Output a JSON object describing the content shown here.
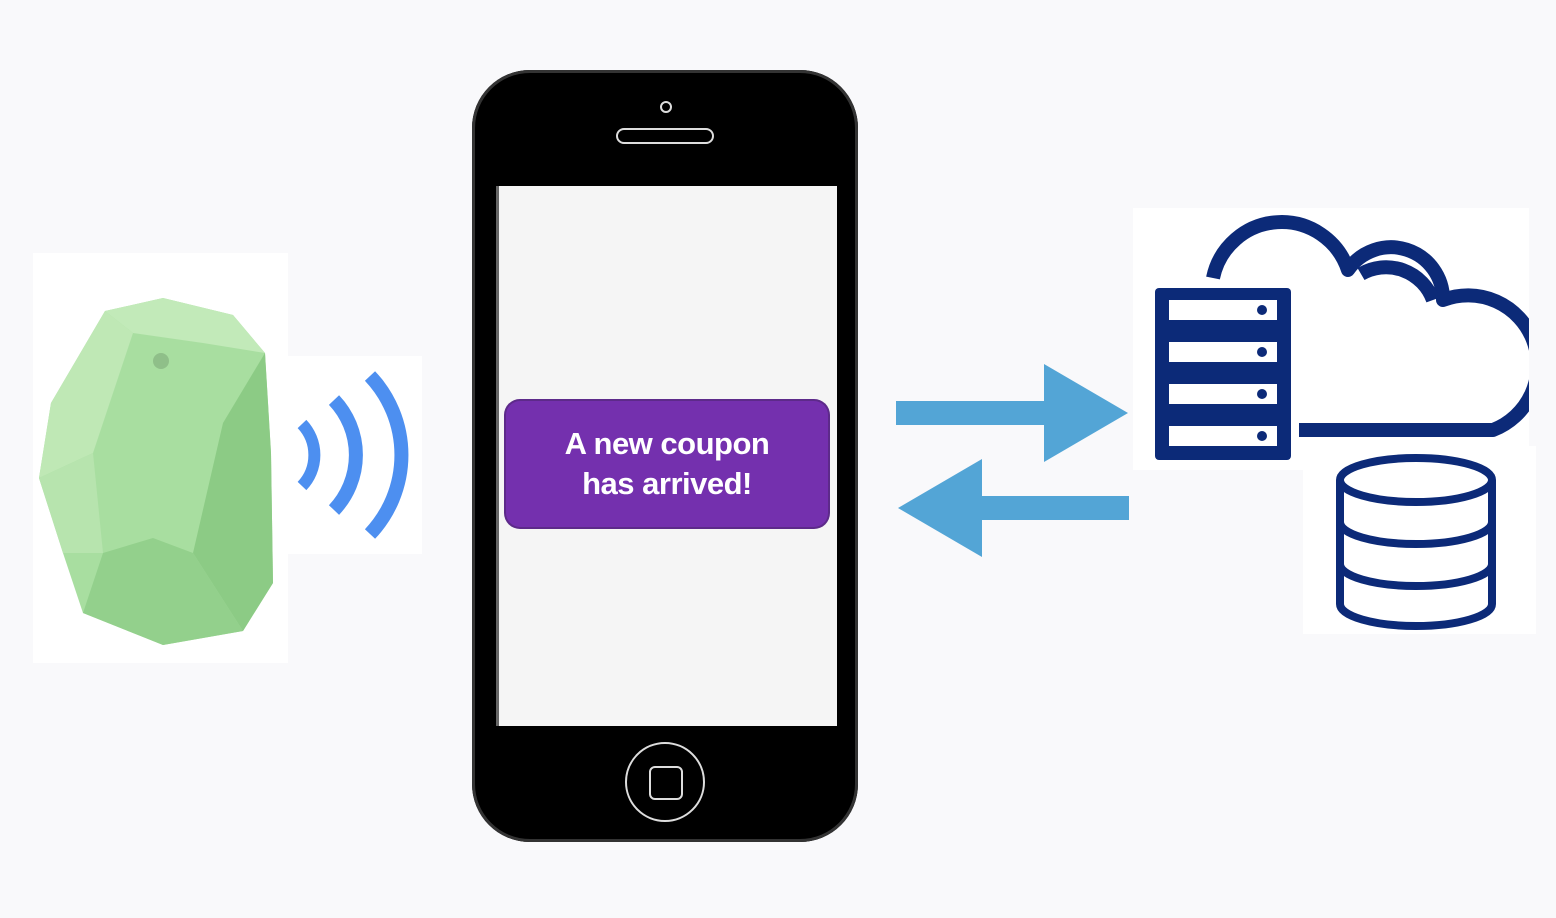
{
  "notification": {
    "line1": "A new coupon",
    "line2": "has arrived!"
  },
  "icons": {
    "beacon": "beacon-icon",
    "signal": "wireless-signal-icon",
    "phone": "smartphone",
    "arrow_right": "arrow-right-icon",
    "arrow_left": "arrow-left-icon",
    "server": "server-rack-icon",
    "cloud": "cloud-icon",
    "database": "database-icon"
  },
  "colors": {
    "beacon_green": "#a8dea0",
    "signal_blue": "#4d8ff0",
    "arrow_blue": "#53a5d6",
    "server_navy": "#0c2a78",
    "notification_purple": "#7430ae"
  }
}
